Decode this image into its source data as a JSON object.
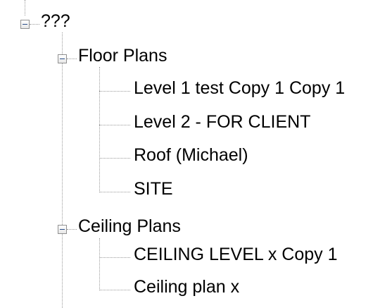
{
  "tree": {
    "root": {
      "label": "???",
      "expanded": true,
      "children": [
        {
          "label": "Floor Plans",
          "expanded": true,
          "children": [
            {
              "label": "Level 1 test Copy 1 Copy 1"
            },
            {
              "label": "Level 2 - FOR CLIENT"
            },
            {
              "label": "Roof (Michael)"
            },
            {
              "label": "SITE"
            }
          ]
        },
        {
          "label": "Ceiling Plans",
          "expanded": true,
          "children": [
            {
              "label": "CEILING LEVEL x Copy 1"
            },
            {
              "label": "Ceiling plan x"
            }
          ]
        }
      ]
    }
  },
  "colors": {
    "connector": "#9a9a9a",
    "toggle_border": "#919191",
    "toggle_sign": "#2b4f8a",
    "text": "#000000"
  },
  "icons": {
    "collapse": "minus-box-icon"
  }
}
